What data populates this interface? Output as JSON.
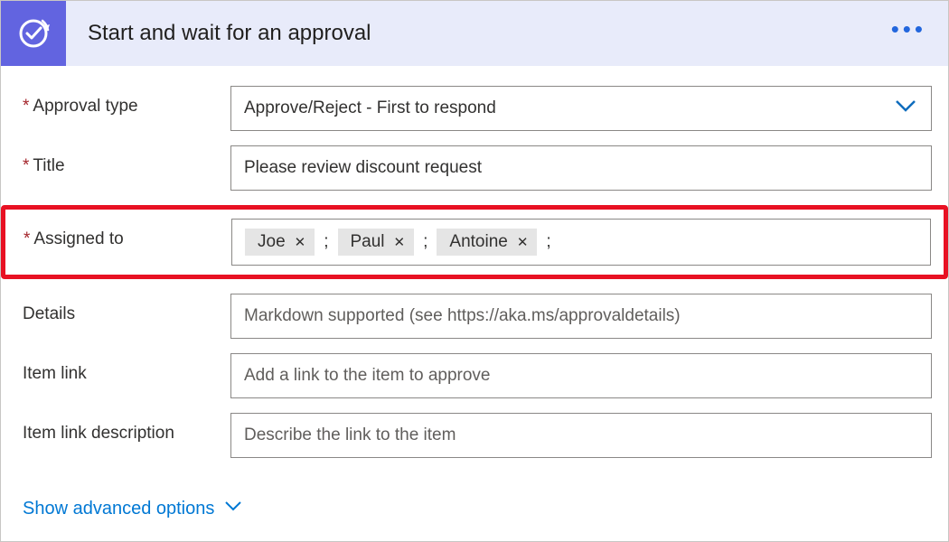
{
  "header": {
    "title": "Start and wait for an approval",
    "icon": "approval-icon",
    "more": "..."
  },
  "fields": {
    "approval_type": {
      "label": "Approval type",
      "required": true,
      "value": "Approve/Reject - First to respond"
    },
    "title": {
      "label": "Title",
      "required": true,
      "value": "Please review discount request"
    },
    "assigned_to": {
      "label": "Assigned to",
      "required": true,
      "tags": [
        "Joe",
        "Paul",
        "Antoine"
      ],
      "separator": ";"
    },
    "details": {
      "label": "Details",
      "required": false,
      "placeholder": "Markdown supported (see https://aka.ms/approvaldetails)"
    },
    "item_link": {
      "label": "Item link",
      "required": false,
      "placeholder": "Add a link to the item to approve"
    },
    "item_link_description": {
      "label": "Item link description",
      "required": false,
      "placeholder": "Describe the link to the item"
    }
  },
  "advanced": {
    "label": "Show advanced options"
  }
}
